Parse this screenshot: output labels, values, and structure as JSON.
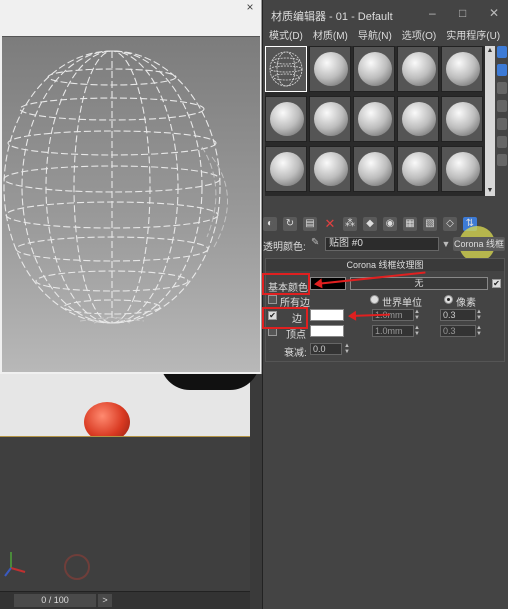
{
  "viewport": {
    "timeline_frame": "0 / 100",
    "timeline_next": ">"
  },
  "preview_window": {
    "close": "×"
  },
  "editor": {
    "title": "材质编辑器 - 01 - Default",
    "window_buttons": {
      "minimize": "–",
      "maximize": "□",
      "close": "✕"
    },
    "menu": [
      "模式(D)",
      "材质(M)",
      "导航(N)",
      "选项(O)",
      "实用程序(U)"
    ],
    "slot_count": 15,
    "name_row": {
      "label": "透明颜色:",
      "map_field": "贴图 #0",
      "type_button": "Corona 线框"
    },
    "rollout": {
      "title": "Corona 线框纹理图",
      "base_color_label": "基本颜色:",
      "base_color_value": "无",
      "all_edges_label": "所有边",
      "world_units_label": "世界单位",
      "pixels_label": "像素",
      "edge_label": "边",
      "edge_world_value": "1.0mm",
      "edge_pixel_value": "0.3",
      "vertex_label": "顶点",
      "vertex_world_value": "1.0mm",
      "vertex_pixel_value": "0.3",
      "falloff_label": "衰减:",
      "falloff_value": "0.0"
    }
  },
  "colors": {
    "accent": "#e02020",
    "selection": "#3d7bd6",
    "panel": "#444444"
  }
}
